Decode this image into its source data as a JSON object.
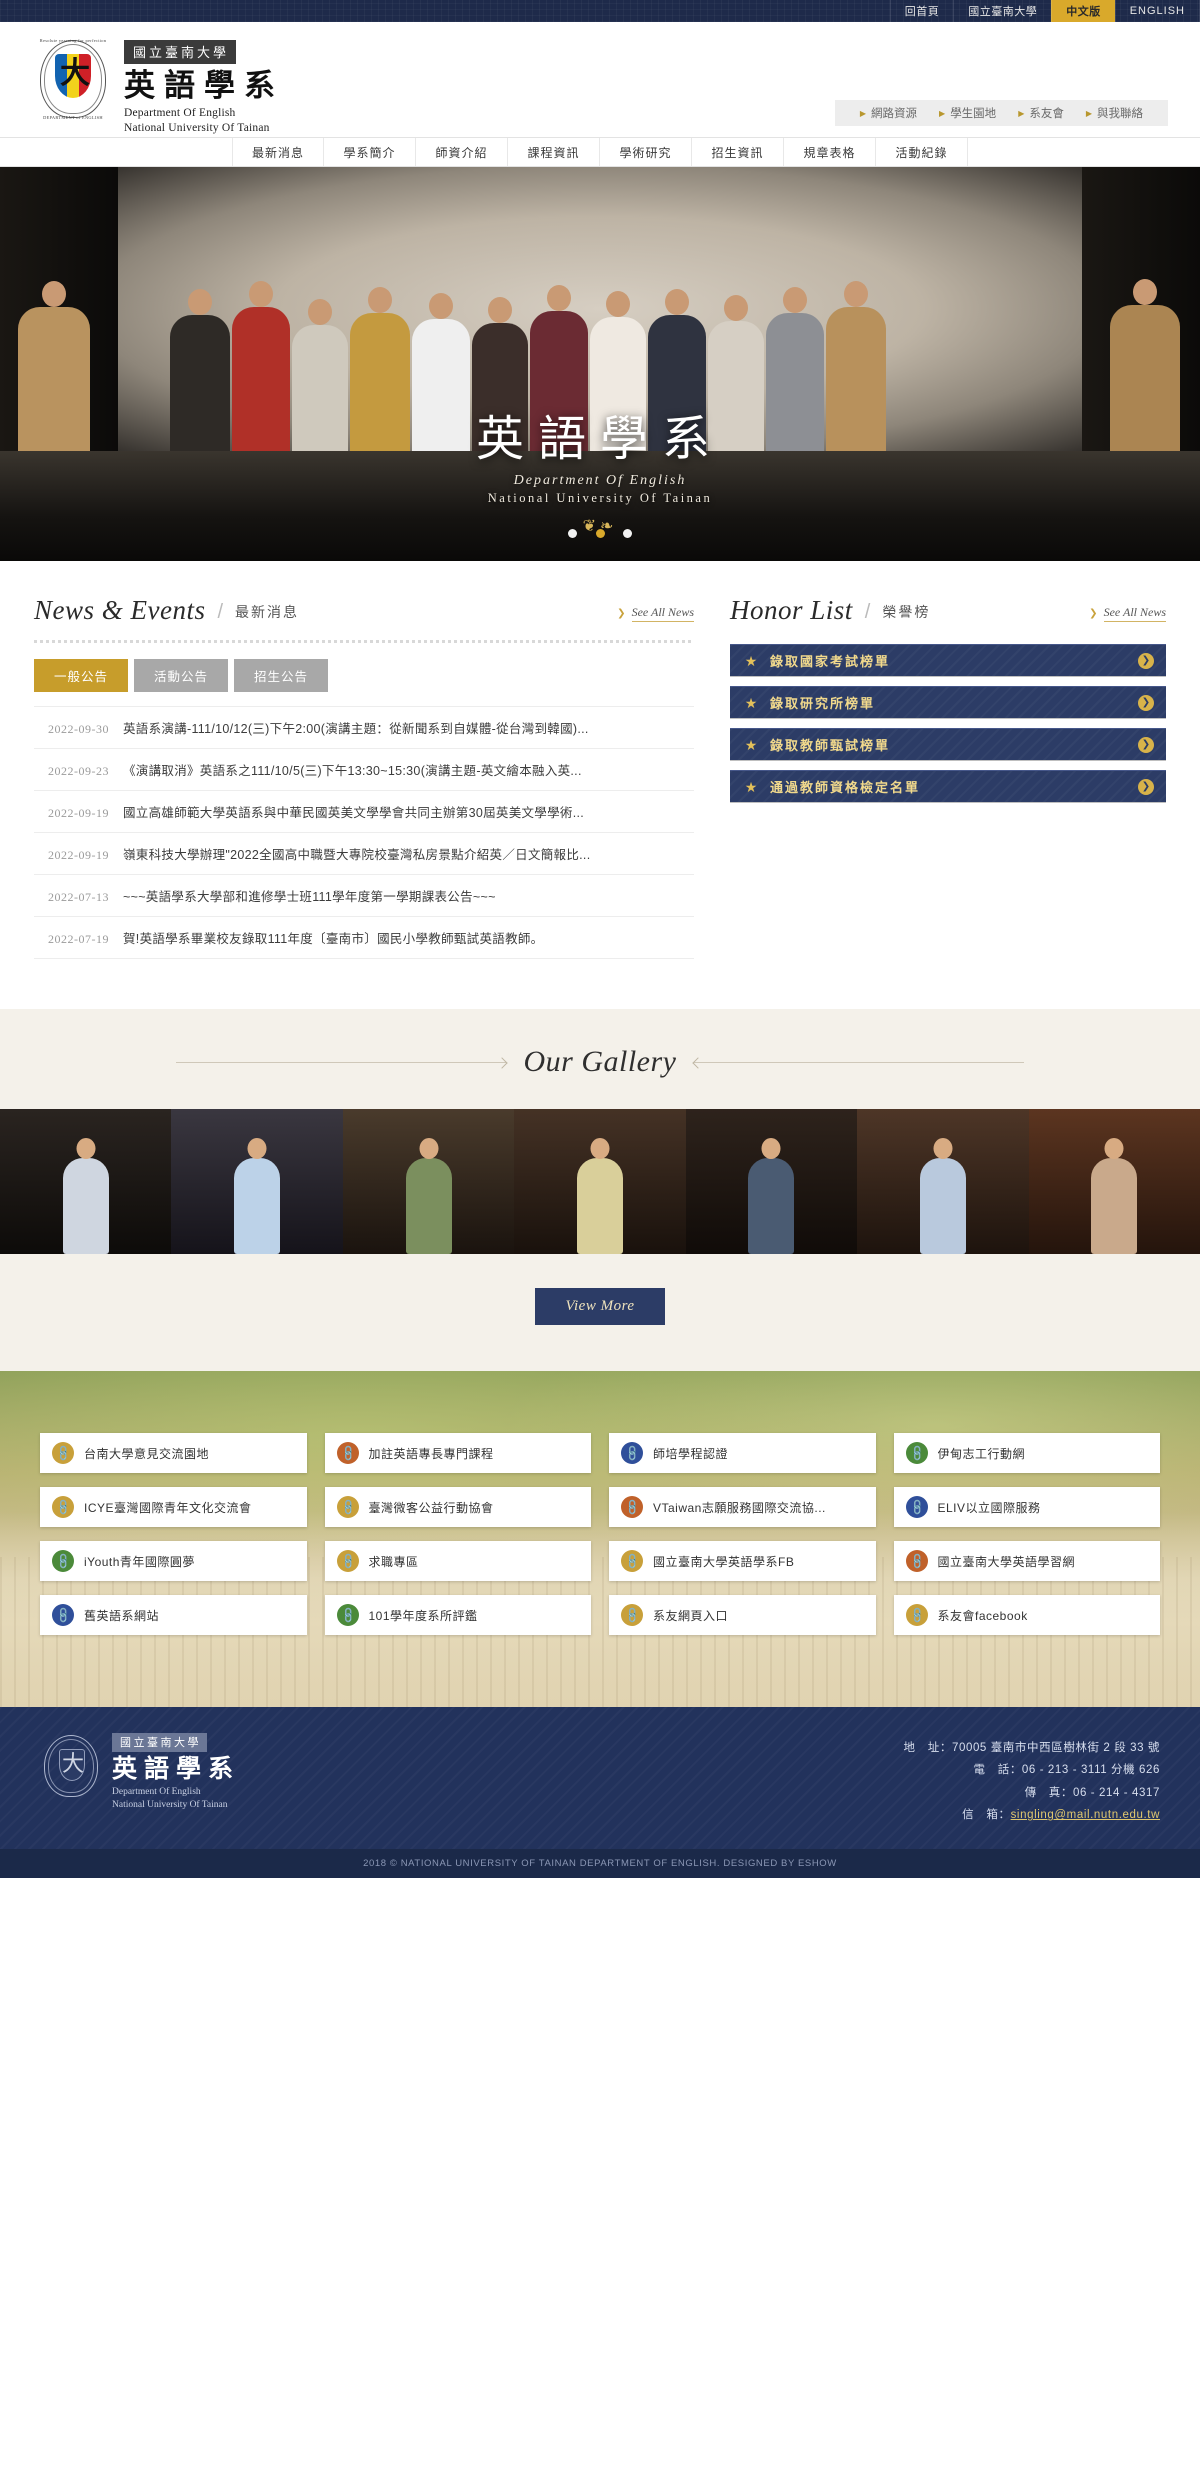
{
  "topbar": {
    "links": [
      {
        "label": "回首頁",
        "active": false
      },
      {
        "label": "國立臺南大學",
        "active": false
      },
      {
        "label": "中文版",
        "active": true
      },
      {
        "label": "ENGLISH",
        "active": false
      }
    ]
  },
  "header": {
    "logo": {
      "university": "國立臺南大學",
      "department": "英語學系",
      "en_line1": "Department Of English",
      "en_line2": "National University Of Tainan",
      "crest_top_text": "Resolute yearning for perfection",
      "crest_bottom_text": "DEPARTMENT of ENGLISH",
      "crest_monogram": "大"
    },
    "subnav": [
      {
        "label": "網路資源"
      },
      {
        "label": "學生園地"
      },
      {
        "label": "系友會"
      },
      {
        "label": "與我聯絡"
      }
    ]
  },
  "mainnav": [
    {
      "label": "最新消息"
    },
    {
      "label": "學系簡介"
    },
    {
      "label": "師資介紹"
    },
    {
      "label": "課程資訊"
    },
    {
      "label": "學術研究"
    },
    {
      "label": "招生資訊"
    },
    {
      "label": "規章表格"
    },
    {
      "label": "活動紀錄"
    }
  ],
  "hero": {
    "title_cn": "英語學系",
    "title_en1": "Department Of English",
    "title_en2": "National University Of Tainan",
    "dots": [
      {
        "active": false
      },
      {
        "active": true
      },
      {
        "active": false
      }
    ]
  },
  "news": {
    "title_en": "News & Events",
    "title_cn": "最新消息",
    "see_all": "See All News",
    "tabs": [
      {
        "label": "一般公告",
        "active": true
      },
      {
        "label": "活動公告",
        "active": false
      },
      {
        "label": "招生公告",
        "active": false
      }
    ],
    "items": [
      {
        "date": "2022-09-30",
        "title": "英語系演講-111/10/12(三)下午2:00(演講主題：從新聞系到自媒體-從台灣到韓國)..."
      },
      {
        "date": "2022-09-23",
        "title": "《演講取消》英語系之111/10/5(三)下午13:30~15:30(演講主題-英文繪本融入英..."
      },
      {
        "date": "2022-09-19",
        "title": "國立高雄師範大學英語系與中華民國英美文學學會共同主辦第30屆英美文學學術..."
      },
      {
        "date": "2022-09-19",
        "title": "嶺東科技大學辦理\"2022全國高中職暨大專院校臺灣私房景點介紹英／日文簡報比..."
      },
      {
        "date": "2022-07-13",
        "title": "~~~英語學系大學部和進修學士班111學年度第一學期課表公告~~~"
      },
      {
        "date": "2022-07-19",
        "title": "賀!英語學系畢業校友錄取111年度〔臺南市〕國民小學教師甄試英語教師。"
      }
    ]
  },
  "honor": {
    "title_en": "Honor List",
    "title_cn": "榮譽榜",
    "see_all": "See All News",
    "items": [
      {
        "label": "錄取國家考試榜單"
      },
      {
        "label": "錄取研究所榜單"
      },
      {
        "label": "錄取教師甄試榜單"
      },
      {
        "label": "通過教師資格檢定名單"
      }
    ]
  },
  "gallery": {
    "title": "Our Gallery",
    "view_more": "View More",
    "photos": [
      {
        "bg": "#1a1410",
        "person": "#cfd6e0"
      },
      {
        "bg": "#2b2a33",
        "person": "#bcd2e8"
      },
      {
        "bg": "#3a2f26",
        "person": "#7b8f5e"
      },
      {
        "bg": "#33261c",
        "person": "#d9cf9a"
      },
      {
        "bg": "#241b16",
        "person": "#4a5b72"
      },
      {
        "bg": "#3e2b20",
        "person": "#b9c9dd"
      },
      {
        "bg": "#4a2b1c",
        "person": "#c9a98b"
      }
    ]
  },
  "links": [
    {
      "label": "台南大學意見交流園地",
      "color": "#c8a03a"
    },
    {
      "label": "加註英語專長專門課程",
      "color": "#c0612a"
    },
    {
      "label": "師培學程認證",
      "color": "#2f4f9a"
    },
    {
      "label": "伊甸志工行動網",
      "color": "#4b8a3a"
    },
    {
      "label": "ICYE臺灣國際青年文化交流會",
      "color": "#c8a03a"
    },
    {
      "label": "臺灣微客公益行動協會",
      "color": "#c8a03a"
    },
    {
      "label": "VTaiwan志願服務國際交流協...",
      "color": "#c0612a"
    },
    {
      "label": "ELIV以立國際服務",
      "color": "#2f4f9a"
    },
    {
      "label": "iYouth青年國際圓夢",
      "color": "#4b8a3a"
    },
    {
      "label": "求職專區",
      "color": "#c8a03a"
    },
    {
      "label": "國立臺南大學英語學系FB",
      "color": "#c8a03a"
    },
    {
      "label": "國立臺南大學英語學習網",
      "color": "#c0612a"
    },
    {
      "label": "舊英語系網站",
      "color": "#2f4f9a"
    },
    {
      "label": "101學年度系所評鑑",
      "color": "#4b8a3a"
    },
    {
      "label": "系友網頁入口",
      "color": "#c8a03a"
    },
    {
      "label": "系友會facebook",
      "color": "#c8a03a"
    }
  ],
  "footer": {
    "logo": {
      "university": "國立臺南大學",
      "department": "英語學系",
      "en_line1": "Department Of English",
      "en_line2": "National University Of Tainan",
      "crest_monogram": "大"
    },
    "contact": [
      {
        "label": "地　址：",
        "value": "70005 臺南市中西區樹林街 2 段 33 號",
        "link": false
      },
      {
        "label": "電　話：",
        "value": "06 - 213 - 3111 分機 626",
        "link": false
      },
      {
        "label": "傳　真：",
        "value": "06 - 214 - 4317",
        "link": false
      },
      {
        "label": "信　箱：",
        "value": "singling@mail.nutn.edu.tw",
        "link": true
      }
    ],
    "copyright": "2018 © NATIONAL UNIVERSITY OF TAINAN DEPARTMENT OF ENGLISH. DESIGNED BY ESHOW"
  }
}
